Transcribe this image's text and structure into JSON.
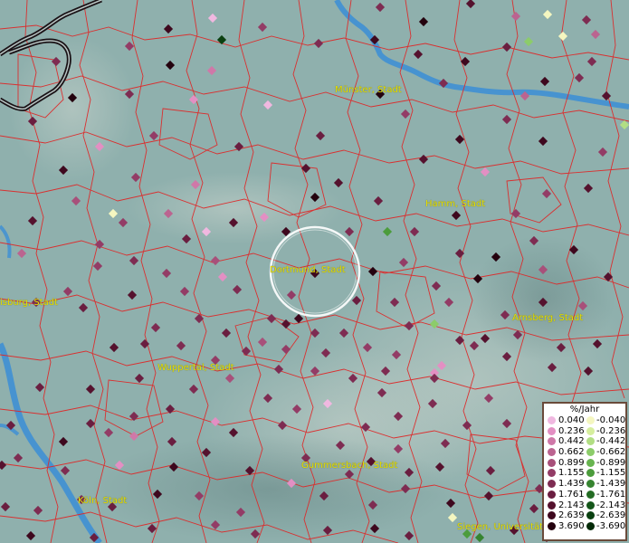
{
  "legend": {
    "title": "%/Jahr",
    "positive": [
      {
        "label": "0.040",
        "color": "#f0b8e0"
      },
      {
        "label": "0.236",
        "color": "#e38fc3"
      },
      {
        "label": "0.442",
        "color": "#cf78a8"
      },
      {
        "label": "0.662",
        "color": "#bb6490"
      },
      {
        "label": "0.899",
        "color": "#a8507a"
      },
      {
        "label": "1.155",
        "color": "#933c66"
      },
      {
        "label": "1.439",
        "color": "#7e2c52"
      },
      {
        "label": "1.761",
        "color": "#6a1e40"
      },
      {
        "label": "2.143",
        "color": "#55122e"
      },
      {
        "label": "2.639",
        "color": "#3e081e"
      },
      {
        "label": "3.690",
        "color": "#24020e"
      }
    ],
    "negative": [
      {
        "label": "-0.040",
        "color": "#f4f6c0"
      },
      {
        "label": "-0.236",
        "color": "#d6ee9e"
      },
      {
        "label": "-0.442",
        "color": "#b2de84"
      },
      {
        "label": "-0.662",
        "color": "#8ccc6a"
      },
      {
        "label": "-0.899",
        "color": "#68b450"
      },
      {
        "label": "-1.155",
        "color": "#4c9c3c"
      },
      {
        "label": "-1.439",
        "color": "#368430"
      },
      {
        "label": "-1.761",
        "color": "#246c24"
      },
      {
        "label": "-2.143",
        "color": "#15561a"
      },
      {
        "label": "-2.639",
        "color": "#0a4010"
      },
      {
        "label": "-3.690",
        "color": "#042a08"
      }
    ]
  },
  "cities": [
    {
      "name": "Münster, Stadt"
    },
    {
      "name": "Hamm, Stadt"
    },
    {
      "name": "Dortmund, Stadt"
    },
    {
      "name": "isburg, Stadt"
    },
    {
      "name": "Arnsberg, Stadt"
    },
    {
      "name": "Wuppertal, Stadt"
    },
    {
      "name": "Gummersbach, Stadt"
    },
    {
      "name": "Köln, Stadt"
    },
    {
      "name": "Siegen, Universitäts"
    }
  ],
  "colors": {
    "terrain": "#8fb0ad",
    "border": "#dd2a2a",
    "river": "#3b8ed6",
    "highway": "#1a1216",
    "label": "#e8e000"
  },
  "station_categories": [
    "p3",
    "p5",
    "n6",
    "p6",
    "p5",
    "p7",
    "p8",
    "p9",
    "n1",
    "n2",
    "p1",
    "p4"
  ]
}
